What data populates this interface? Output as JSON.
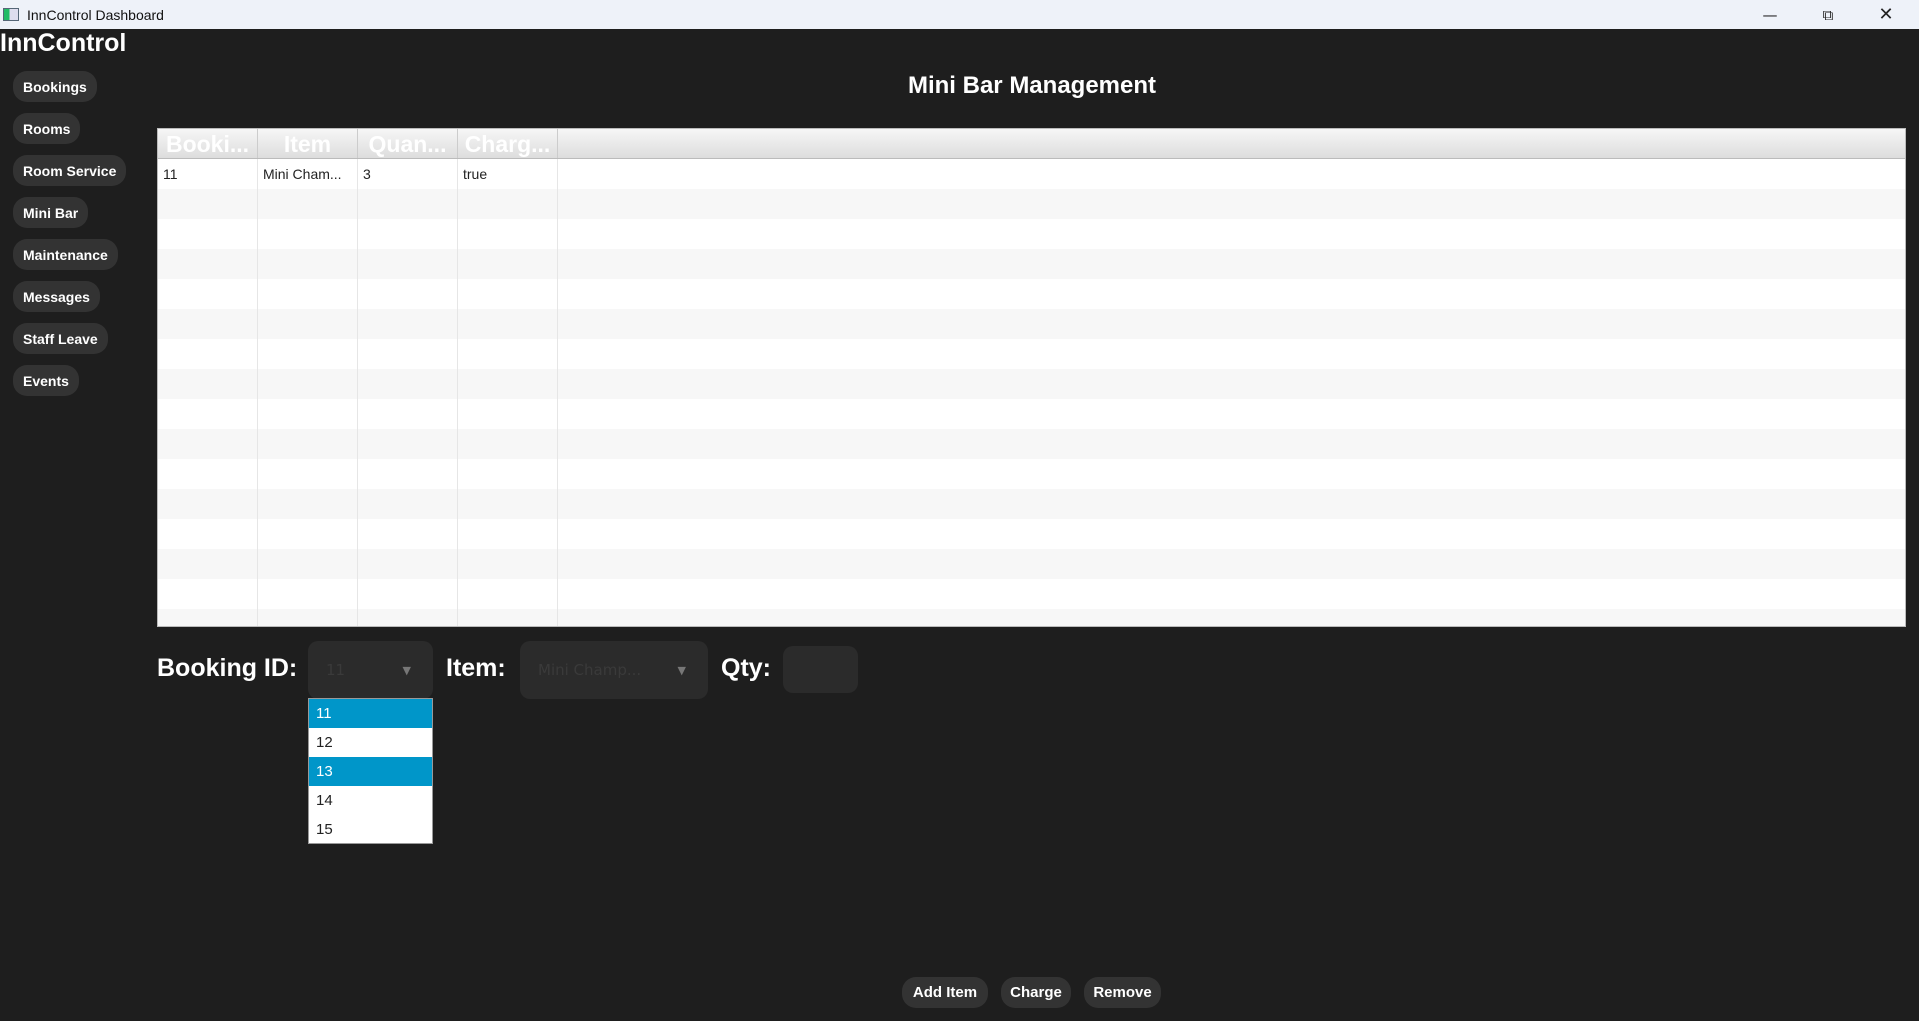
{
  "window": {
    "title": "InnControl Dashboard",
    "controls": [
      "minimize",
      "restore",
      "close"
    ]
  },
  "app": {
    "logo": "InnControl"
  },
  "sidebar": {
    "items": [
      {
        "label": "Bookings"
      },
      {
        "label": "Rooms"
      },
      {
        "label": "Room Service"
      },
      {
        "label": "Mini Bar"
      },
      {
        "label": "Maintenance"
      },
      {
        "label": "Messages"
      },
      {
        "label": "Staff Leave"
      },
      {
        "label": "Events"
      }
    ]
  },
  "page": {
    "title": "Mini Bar Management"
  },
  "table": {
    "headers": [
      "Booki...",
      "Item",
      "Quan...",
      "Charg..."
    ],
    "rows": [
      [
        "11",
        "Mini Cham...",
        "3",
        "true"
      ]
    ]
  },
  "form": {
    "booking_label": "Booking ID:",
    "booking_value": "11",
    "item_label": "Item:",
    "item_value": "Mini Champ...",
    "qty_label": "Qty:",
    "qty_value": ""
  },
  "dropdown": {
    "options": [
      "11",
      "12",
      "13",
      "14",
      "15"
    ],
    "selected": "11",
    "hovered": "13"
  },
  "buttons": {
    "add": "Add Item",
    "charge": "Charge",
    "remove": "Remove"
  },
  "colors": {
    "accent": "#0096c9",
    "background": "#1e1e1e"
  }
}
